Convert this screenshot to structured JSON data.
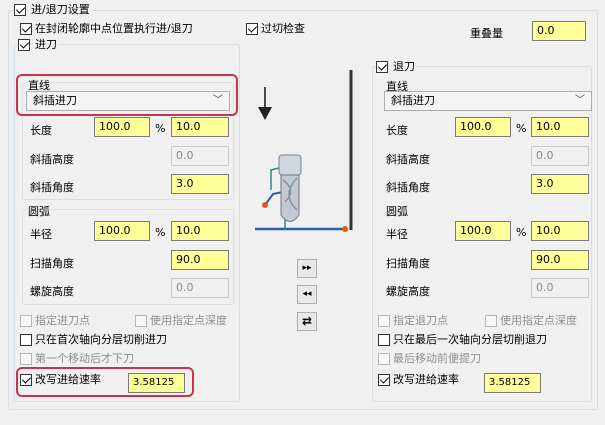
{
  "header": {
    "main_checkbox": "进/退刀设置",
    "contour_midpoint": "在封闭轮廓中点位置执行进/退刀",
    "overcut_check": "过切检查",
    "overlap_label": "重叠量",
    "overlap_value": "0.0"
  },
  "lead_in": {
    "checkbox": "进刀",
    "line_group": "直线",
    "line_type": "斜插进刀",
    "length_label": "长度",
    "length_value": "100.0",
    "percent": "%",
    "length_abs": "10.0",
    "ramp_height_label": "斜插高度",
    "ramp_height_value": "0.0",
    "ramp_angle_label": "斜插角度",
    "ramp_angle_value": "3.0",
    "arc_group": "圆弧",
    "radius_label": "半径",
    "radius_value": "100.0",
    "radius_abs": "10.0",
    "sweep_label": "扫描角度",
    "sweep_value": "90.0",
    "helix_label": "螺旋高度",
    "helix_value": "0.0",
    "specify_point": "指定进刀点",
    "use_point_depth": "使用指定点深度",
    "first_depth_only": "只在首次轴向分层切削进刀",
    "first_move_down": "第一个移动后才下刀",
    "override_feed": "改写进给速率",
    "feed_value": "3.58125"
  },
  "lead_out": {
    "checkbox": "退刀",
    "line_group": "直线",
    "line_type": "斜插进刀",
    "length_label": "长度",
    "length_value": "100.0",
    "percent": "%",
    "length_abs": "10.0",
    "ramp_height_label": "斜插高度",
    "ramp_height_value": "0.0",
    "ramp_angle_label": "斜插角度",
    "ramp_angle_value": "3.0",
    "arc_group": "圆弧",
    "radius_label": "半径",
    "radius_value": "100.0",
    "radius_abs": "10.0",
    "sweep_label": "扫描角度",
    "sweep_value": "90.0",
    "helix_label": "螺旋高度",
    "helix_value": "0.0",
    "specify_point": "指定退刀点",
    "use_point_depth": "使用指定点深度",
    "last_depth_only": "只在最后一次轴向分层切削退刀",
    "lift_before_last": "最后移动前便提刀",
    "override_feed": "改写进给速率",
    "feed_value": "3.58125"
  },
  "buttons": {
    "copy_right": "▸▸",
    "copy_left": "◂◂",
    "swap": "⇄"
  },
  "colors": {
    "highlight_border": "#c8344f",
    "yellow_field": "#ffff99",
    "tool_path": "#2b5fa3",
    "path_endpoint": "#e05a20"
  }
}
